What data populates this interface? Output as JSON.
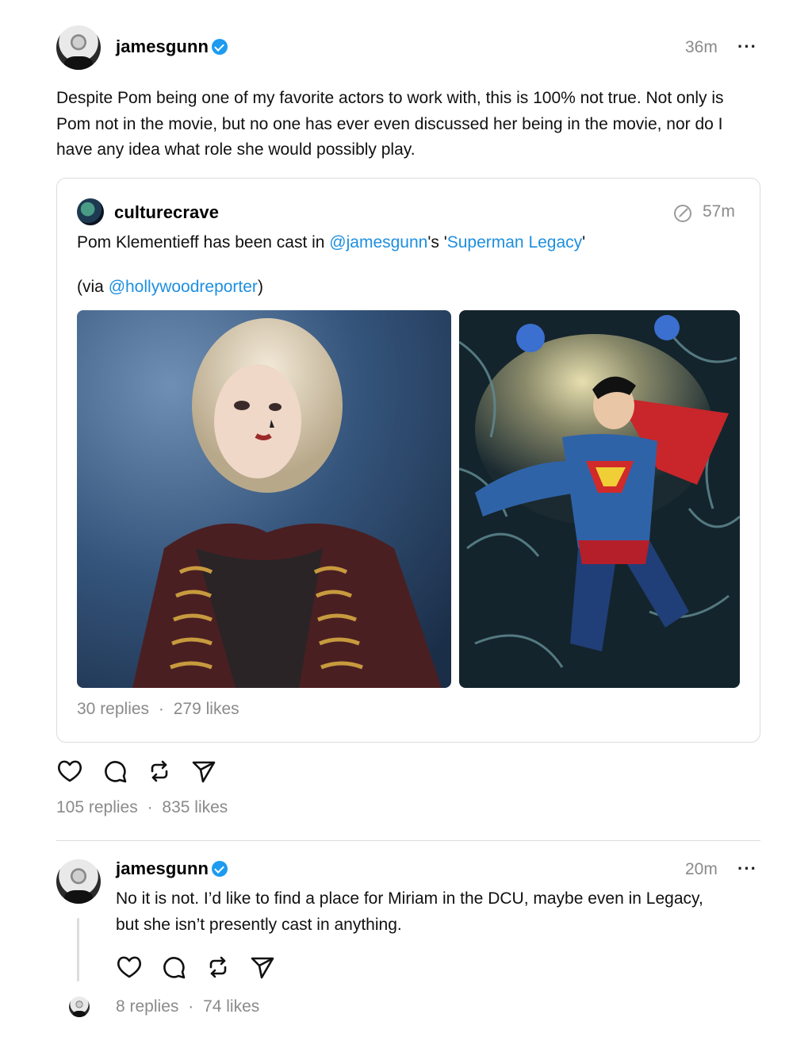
{
  "post": {
    "username": "jamesgunn",
    "time": "36m",
    "more": "···",
    "text": "Despite Pom being one of my favorite actors to work with, this is 100% not true. Not only is Pom not in the movie, but no one has ever even discussed her being in the movie, nor do I have any idea what role she would possibly play.",
    "replies": "105 replies",
    "sep": "·",
    "likes": "835 likes"
  },
  "quote": {
    "username": "culturecrave",
    "time": "57m",
    "text_before": "Pom Klementieff has been cast in ",
    "mention": "@jamesgunn",
    "text_middle": "'s '",
    "title_link": "Superman Legacy",
    "text_after": "'",
    "via_prefix": "(via ",
    "via_link": "@hollywoodreporter",
    "via_suffix": ")",
    "replies": "30 replies",
    "sep": "·",
    "likes": "279 likes"
  },
  "reply": {
    "username": "jamesgunn",
    "time": "20m",
    "more": "···",
    "text": "No it is not. I’d like to find a place for Miriam in the DCU, maybe even in Legacy, but she isn’t presently cast in anything.",
    "replies": "8 replies",
    "sep": "·",
    "likes": "74 likes"
  },
  "icons": [
    "heart-icon",
    "comment-icon",
    "repost-icon",
    "share-icon",
    "edited-icon"
  ],
  "colors": {
    "link": "#1d8fe0",
    "verified": "#1d9bf0",
    "muted": "#8a8a8a"
  }
}
